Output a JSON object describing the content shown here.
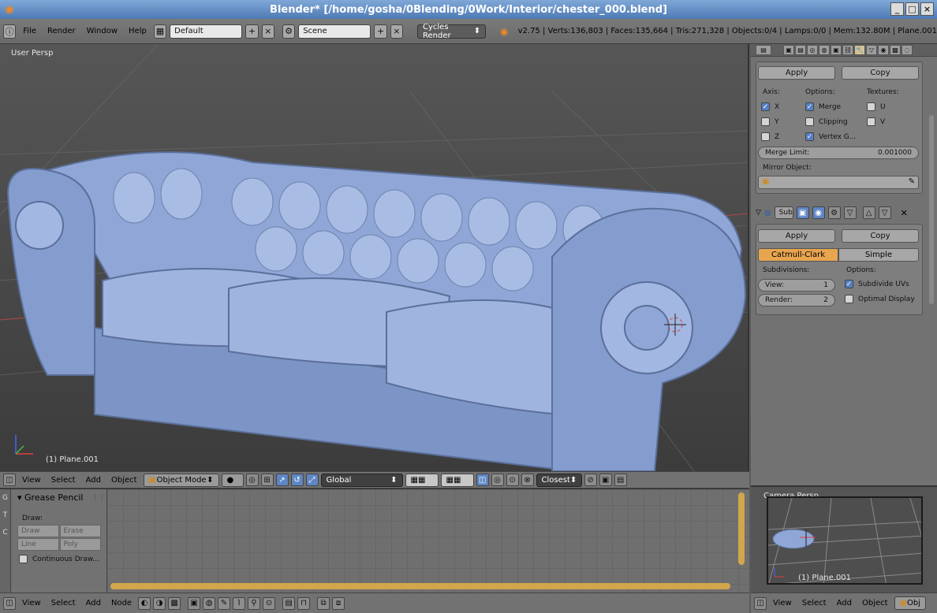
{
  "window": {
    "title": "Blender* [/home/gosha/0Blending/0Work/Interior/chester_000.blend]",
    "buttons": [
      "_",
      "□",
      "×"
    ]
  },
  "info": {
    "menus": [
      "File",
      "Render",
      "Window",
      "Help"
    ],
    "layout": "Default",
    "scene": "Scene",
    "engine": "Cycles Render",
    "stats": "v2.75 | Verts:136,803 | Faces:135,664 | Tris:271,328 | Objects:0/4 | Lamps:0/0 | Mem:132.80M | Plane.001"
  },
  "viewport": {
    "view_label": "User Persp",
    "object_label": "(1) Plane.001",
    "menus": [
      "View",
      "Select",
      "Add",
      "Object"
    ],
    "mode": "Object Mode",
    "orientation": "Global",
    "snap": "Closest"
  },
  "mirror_modifier": {
    "apply": "Apply",
    "copy": "Copy",
    "axis_label": "Axis:",
    "options_label": "Options:",
    "textures_label": "Textures:",
    "axis": [
      {
        "label": "X",
        "checked": true
      },
      {
        "label": "Y",
        "checked": false
      },
      {
        "label": "Z",
        "checked": false
      }
    ],
    "options": [
      {
        "label": "Merge",
        "checked": true
      },
      {
        "label": "Clipping",
        "checked": false
      },
      {
        "label": "Vertex G...",
        "checked": true
      }
    ],
    "textures": [
      {
        "label": "U",
        "checked": false
      },
      {
        "label": "V",
        "checked": false
      }
    ],
    "merge_limit_label": "Merge Limit:",
    "merge_limit_value": "0.001000",
    "mirror_object_label": "Mirror Object:"
  },
  "subsurf_modifier": {
    "name": "Sub",
    "apply": "Apply",
    "copy": "Copy",
    "tab_active": "Catmull-Clark",
    "tab_other": "Simple",
    "subdivisions_label": "Subdivisions:",
    "options_label": "Options:",
    "view_label": "View:",
    "view_value": "1",
    "render_label": "Render:",
    "render_value": "2",
    "subdivide_uvs": "Subdivide UVs",
    "optimal_display": "Optimal Display"
  },
  "grease_pencil": {
    "title": "Grease Pencil",
    "draw_label": "Draw:",
    "buttons": [
      "Draw",
      "Erase",
      "Line",
      "Poly"
    ],
    "continuous": "Continuous Draw...",
    "tabs": [
      "G",
      "T",
      "C"
    ]
  },
  "node_editor": {
    "menus": [
      "View",
      "Select",
      "Add",
      "Node"
    ]
  },
  "camera_view": {
    "label": "Camera Persp",
    "object_label": "(1) Plane.001",
    "menus": [
      "View",
      "Select",
      "Add",
      "Object"
    ],
    "cut_label": "Obj"
  },
  "colors": {
    "accent_blue": "#5680c2",
    "active_tab": "#e8a550",
    "scroll": "#d2a64c",
    "sofa": "#8fa6d6"
  }
}
